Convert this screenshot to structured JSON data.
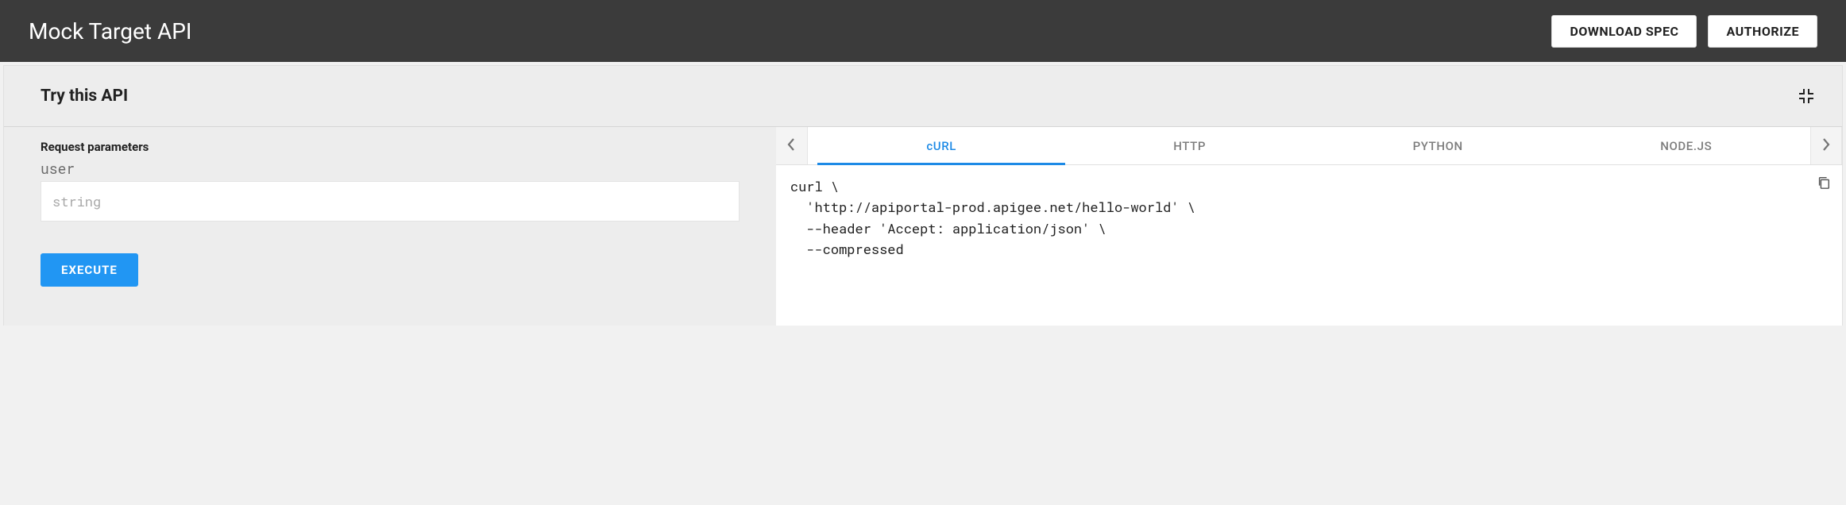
{
  "header": {
    "title": "Mock Target API",
    "download_label": "DOWNLOAD SPEC",
    "authorize_label": "AUTHORIZE"
  },
  "panel": {
    "title": "Try this API",
    "request_params_label": "Request parameters",
    "params": {
      "name": "user",
      "placeholder": "string",
      "value": ""
    },
    "execute_label": "EXECUTE"
  },
  "tabs": {
    "items": [
      "cURL",
      "HTTP",
      "PYTHON",
      "NODE.JS"
    ],
    "active_index": 0
  },
  "code": {
    "curl": "curl \\\n  'http://apiportal-prod.apigee.net/hello-world' \\\n  --header 'Accept: application/json' \\\n  --compressed"
  }
}
